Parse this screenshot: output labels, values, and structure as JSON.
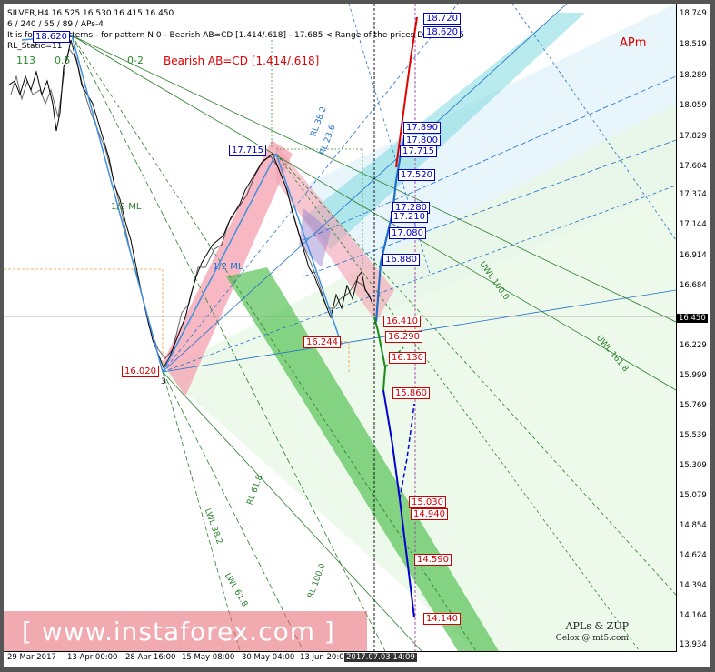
{
  "header": {
    "line1": "SILVER,H4  16.525 16.530 16.415 16.450",
    "line2": "6 / 240 / 55 / 89 / APs-4",
    "line3": "It is found 1 patterns  -  for pattern N 0 - Bearish AB=CD [1.414/.618] - 17.685 < Range of the prices D < 18.315",
    "line4": "RL_Static=11",
    "fibo_left": "113",
    "fibo_mid": "0.5",
    "fibo_right": "0-2",
    "pattern_label": "Bearish AB=CD [1.414/.618]",
    "apm": "APm"
  },
  "y_axis": {
    "ticks": [
      "18.749",
      "18.519",
      "18.289",
      "18.059",
      "17.829",
      "17.604",
      "17.374",
      "17.144",
      "16.914",
      "16.684",
      "16.450",
      "16.229",
      "15.999",
      "15.769",
      "15.539",
      "15.309",
      "15.079",
      "14.854",
      "14.624",
      "14.394",
      "14.164",
      "13.934"
    ],
    "current_price": "16.450"
  },
  "x_axis": {
    "labels": [
      "29 Mar 2017",
      "13 Apr 00:00",
      "28 Apr 16:00",
      "15 May 08:00",
      "30 May 04:00",
      "13 Jun 20:00",
      "2017.07.03 14:09"
    ]
  },
  "levels_blue": [
    "18.720",
    "18.620",
    "17.890",
    "17.800",
    "17.715",
    "17.520",
    "17.280",
    "17.210",
    "17.080",
    "16.880"
  ],
  "levels_red": [
    "16.410",
    "16.290",
    "16.130",
    "15.860",
    "15.030",
    "14.940",
    "14.590",
    "14.140"
  ],
  "pivots": {
    "top_left": "18.620",
    "peak": "17.715",
    "low": "16.020",
    "low2": "16.244"
  },
  "lines_text": {
    "ml_upper": "1/2 ML",
    "ml": "1/2 ML",
    "uwl": "UWL 100.0",
    "uwl2": "UWL 161.8",
    "lwl": "LWL 38.2",
    "lwl2": "LWL 61.8",
    "rl": "RL 100.0",
    "rl2": "RL 61.8",
    "rl3": "RL 38.2",
    "rl4": "RL 23.6"
  },
  "watermark": "[  www.instaforex.com  ]",
  "credit1": "APLs & ZUP",
  "credit2": "Gelox @ mt5.com",
  "colors": {
    "cyan_band": "#7fd8e0",
    "green_band": "#5ec85e",
    "pink_band": "#f4a0b0",
    "red_level": "#d00000",
    "blue_level": "#0000c0"
  }
}
